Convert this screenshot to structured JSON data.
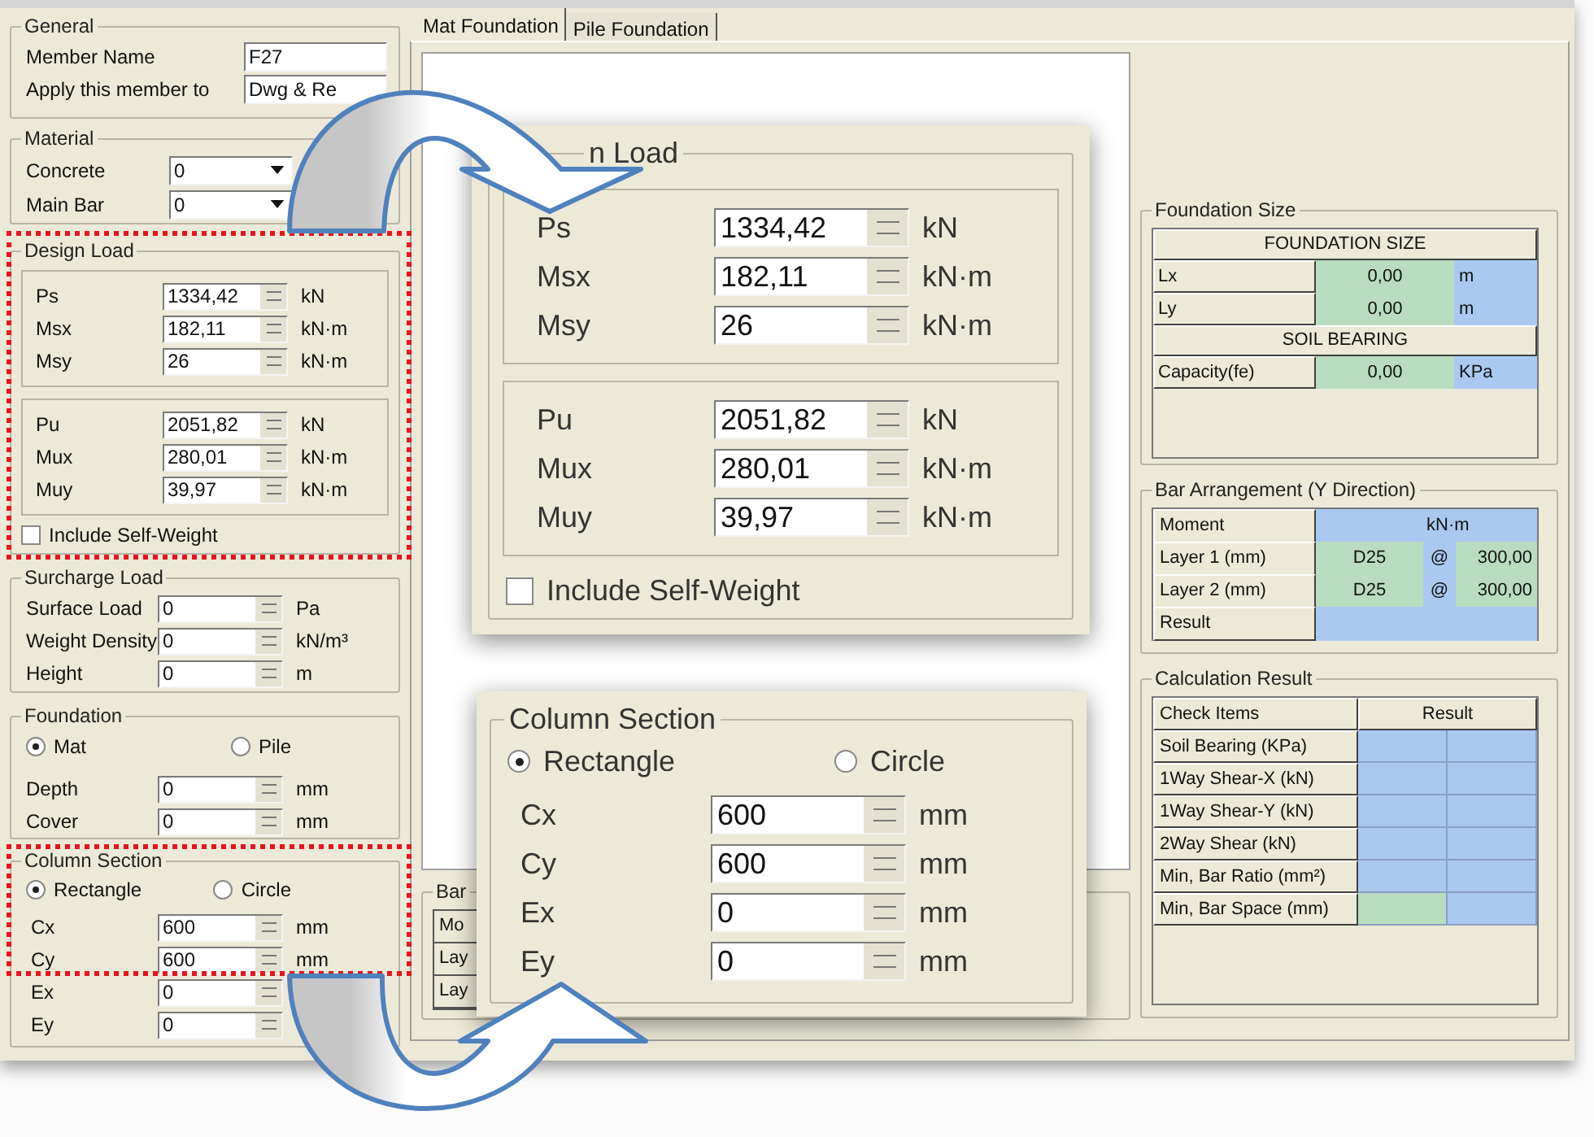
{
  "general": {
    "title": "General",
    "fields": [
      {
        "label": "Member Name",
        "value": "F27"
      },
      {
        "label": "Apply this member to",
        "value": "Dwg & Re"
      }
    ]
  },
  "material": {
    "title": "Material",
    "fields": [
      {
        "label": "Concrete",
        "value": "0"
      },
      {
        "label": "Main Bar",
        "value": "0"
      }
    ]
  },
  "design_load": {
    "title": "Design Load",
    "service": [
      {
        "label": "Ps",
        "value": "1334,42",
        "unit": "kN"
      },
      {
        "label": "Msx",
        "value": "182,11",
        "unit": "kN·m"
      },
      {
        "label": "Msy",
        "value": "26",
        "unit": "kN·m"
      }
    ],
    "ultimate": [
      {
        "label": "Pu",
        "value": "2051,82",
        "unit": "kN"
      },
      {
        "label": "Mux",
        "value": "280,01",
        "unit": "kN·m"
      },
      {
        "label": "Muy",
        "value": "39,97",
        "unit": "kN·m"
      }
    ],
    "self_weight": {
      "label": "Include Self-Weight",
      "checked": false
    }
  },
  "surcharge_load": {
    "title": "Surcharge Load",
    "fields": [
      {
        "label": "Surface Load",
        "value": "0",
        "unit": "Pa"
      },
      {
        "label": "Weight Density",
        "value": "0",
        "unit": "kN/m³"
      },
      {
        "label": "Height",
        "value": "0",
        "unit": "m"
      }
    ]
  },
  "foundation": {
    "title": "Foundation",
    "options": [
      {
        "label": "Mat",
        "selected": true
      },
      {
        "label": "Pile",
        "selected": false
      }
    ],
    "fields": [
      {
        "label": "Depth",
        "value": "0",
        "unit": "mm"
      },
      {
        "label": "Cover",
        "value": "0",
        "unit": "mm"
      }
    ]
  },
  "column_section": {
    "title": "Column Section",
    "options": [
      {
        "label": "Rectangle",
        "selected": true
      },
      {
        "label": "Circle",
        "selected": false
      }
    ],
    "fields": [
      {
        "label": "Cx",
        "value": "600",
        "unit": "mm"
      },
      {
        "label": "Cy",
        "value": "600",
        "unit": "mm"
      },
      {
        "label": "Ex",
        "value": "0"
      },
      {
        "label": "Ey",
        "value": "0"
      }
    ]
  },
  "tabs": [
    {
      "label": "Mat Foundation",
      "selected": true
    },
    {
      "label": "Pile Foundation",
      "selected": false
    }
  ],
  "bar_arrangement_x": {
    "title": "Bar",
    "rows": [
      "Mo",
      "Lay",
      "Lay"
    ]
  },
  "foundation_size": {
    "title": "Foundation Size",
    "rows": [
      {
        "kind": "header",
        "label": "FOUNDATION SIZE"
      },
      {
        "kind": "value",
        "label": "Lx",
        "value": "0,00",
        "unit": "m"
      },
      {
        "kind": "value",
        "label": "Ly",
        "value": "0,00",
        "unit": "m"
      },
      {
        "kind": "header",
        "label": "SOIL BEARING"
      },
      {
        "kind": "value",
        "label": "Capacity(fe)",
        "value": "0,00",
        "unit": "KPa"
      }
    ]
  },
  "bar_arrangement_y": {
    "title": "Bar Arrangement (Y Direction)",
    "rows": [
      {
        "kind": "unit",
        "label": "Moment",
        "unit": "kN·m"
      },
      {
        "kind": "layer",
        "label": "Layer 1 (mm)",
        "bar": "D25",
        "at": "@",
        "spacing": "300,00"
      },
      {
        "kind": "layer",
        "label": "Layer 2 (mm)",
        "bar": "D25",
        "at": "@",
        "spacing": "300,00"
      },
      {
        "kind": "blank",
        "label": "Result"
      }
    ]
  },
  "calculation_result": {
    "title": "Calculation Result",
    "columns": [
      "Check Items",
      "Result"
    ],
    "rows": [
      {
        "label": "Soil Bearing (KPa)",
        "cells": [
          {
            "color": "#a9c9f1"
          },
          {
            "color": "#a9c9f1"
          }
        ]
      },
      {
        "label": "1Way Shear-X (kN)",
        "cells": [
          {
            "color": "#a9c9f1"
          },
          {
            "color": "#a9c9f1"
          }
        ]
      },
      {
        "label": "1Way Shear-Y (kN)",
        "cells": [
          {
            "color": "#a9c9f1"
          },
          {
            "color": "#a9c9f1"
          }
        ]
      },
      {
        "label": "2Way Shear (kN)",
        "cells": [
          {
            "color": "#a9c9f1"
          },
          {
            "color": "#a9c9f1"
          }
        ]
      },
      {
        "label": "Min, Bar Ratio (mm²)",
        "cells": [
          {
            "color": "#a9c9f1"
          },
          {
            "color": "#a9c9f1"
          }
        ]
      },
      {
        "label": "Min, Bar Space (mm)",
        "cells": [
          {
            "color": "#b9dcc0"
          },
          {
            "color": "#a9c9f1"
          }
        ]
      }
    ]
  },
  "callouts": [
    {
      "kind": "design_load",
      "title": "n Load",
      "service": [
        {
          "label": "Ps",
          "value": "1334,42",
          "unit": "kN"
        },
        {
          "label": "Msx",
          "value": "182,11",
          "unit": "kN·m"
        },
        {
          "label": "Msy",
          "value": "26",
          "unit": "kN·m"
        }
      ],
      "ultimate": [
        {
          "label": "Pu",
          "value": "2051,82",
          "unit": "kN"
        },
        {
          "label": "Mux",
          "value": "280,01",
          "unit": "kN·m"
        },
        {
          "label": "Muy",
          "value": "39,97",
          "unit": "kN·m"
        }
      ],
      "self_weight": {
        "label": "Include Self-Weight",
        "checked": false
      }
    },
    {
      "kind": "column_section",
      "title": "Column Section",
      "options": [
        {
          "label": "Rectangle",
          "selected": true
        },
        {
          "label": "Circle",
          "selected": false
        }
      ],
      "fields": [
        {
          "label": "Cx",
          "value": "600",
          "unit": "mm"
        },
        {
          "label": "Cy",
          "value": "600",
          "unit": "mm"
        },
        {
          "label": "Ex",
          "value": "0",
          "unit": "mm"
        },
        {
          "label": "Ey",
          "value": "0",
          "unit": "mm"
        }
      ]
    }
  ]
}
